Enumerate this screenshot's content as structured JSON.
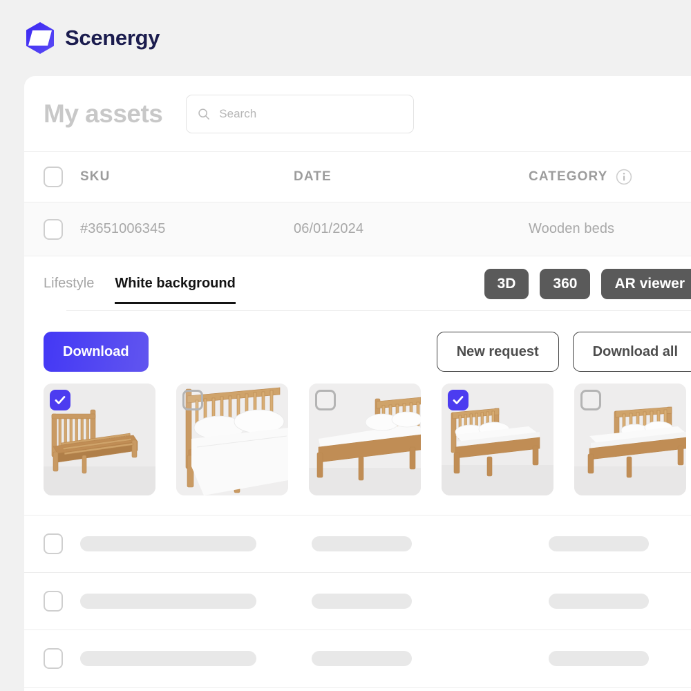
{
  "brand": {
    "name": "Scenergy",
    "logo_icon": "hexagon-logo-icon",
    "logo_color": "#3c2ff0"
  },
  "header": {
    "page_title": "My assets",
    "search": {
      "placeholder": "Search",
      "value": "",
      "icon": "search-icon"
    }
  },
  "table": {
    "columns": [
      "SKU",
      "DATE",
      "CATEGORY"
    ],
    "category_info_icon": "info-circle-icon",
    "rows": [
      {
        "sku": "#3651006345",
        "date": "06/01/2024",
        "category": "Wooden beds",
        "checked": false,
        "expanded": true
      }
    ],
    "placeholder_rows": 3
  },
  "detail": {
    "tabs": [
      {
        "label": "Lifestyle",
        "active": false
      },
      {
        "label": "White background",
        "active": true
      }
    ],
    "view_buttons": [
      {
        "label": "3D"
      },
      {
        "label": "360"
      },
      {
        "label": "AR viewer"
      }
    ],
    "actions": {
      "download": "Download",
      "new_request": "New request",
      "download_all": "Download all"
    },
    "accent_color": "#4c3cf0",
    "thumbnails": [
      {
        "alt": "wooden bed frame with slats",
        "selected": true,
        "variant": "frame"
      },
      {
        "alt": "bed with pillows close up",
        "selected": false,
        "variant": "pillows"
      },
      {
        "alt": "bed side angle",
        "selected": false,
        "variant": "side"
      },
      {
        "alt": "made bed three quarter view",
        "selected": true,
        "variant": "made"
      },
      {
        "alt": "made bed wide view",
        "selected": false,
        "variant": "wide"
      }
    ]
  }
}
